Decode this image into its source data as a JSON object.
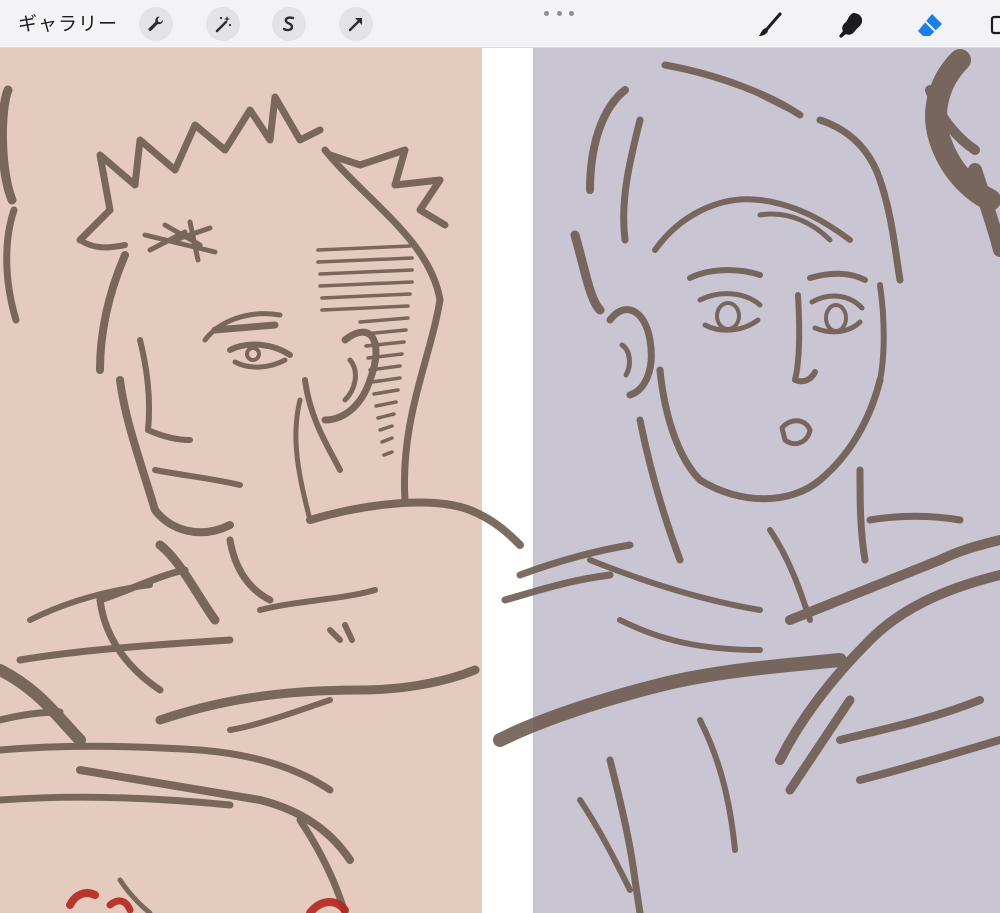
{
  "toolbar": {
    "gallery_label": "ギャラリー",
    "left_tools": [
      "wrench-icon",
      "magic-wand-icon",
      "selection-s-icon",
      "arrow-transform-icon"
    ],
    "more_icon": "ellipsis-icon",
    "right_tools": [
      "brush-icon",
      "smudge-icon",
      "eraser-icon",
      "layers-icon"
    ],
    "active_tool": "eraser-icon"
  },
  "colors": {
    "toolbar_bg": "#f3f3f5",
    "left_canvas": "#e4cbbd",
    "right_canvas": "#c9c5d3",
    "gutter": "#ffffff",
    "ink": "#6b5a4d",
    "accent": "#1a7fe6",
    "red_accent": "#b3261e"
  }
}
